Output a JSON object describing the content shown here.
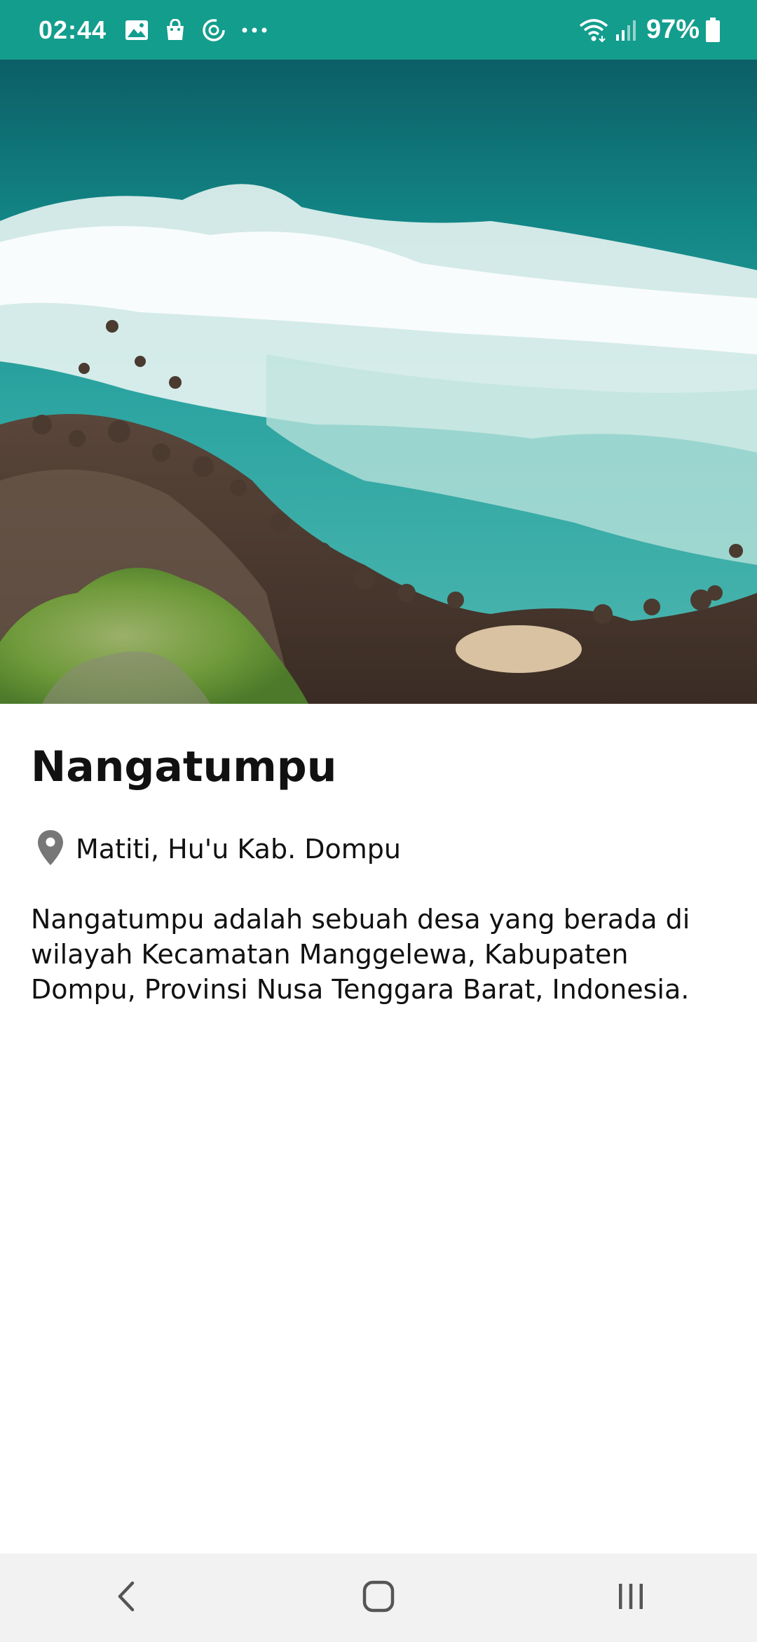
{
  "status_bar": {
    "time": "02:44",
    "battery": "97%",
    "icons": [
      "image-icon",
      "shopping-bag-icon",
      "sync-icon",
      "more-dots-icon",
      "wifi-icon",
      "signal-icon",
      "battery-icon"
    ],
    "background_color": "#139d8d"
  },
  "hero": {
    "image": "aerial-coastline-image"
  },
  "place": {
    "title": "Nangatumpu",
    "location": "Matiti, Hu'u Kab. Dompu",
    "location_icon": "location-pin-icon",
    "description": "Nangatumpu adalah sebuah desa yang berada di wilayah Kecamatan Manggelewa, Kabupaten Dompu, Provinsi Nusa Tenggara Barat, Indonesia."
  },
  "nav_bar": {
    "buttons": [
      "back-icon",
      "home-icon",
      "recents-icon"
    ]
  }
}
